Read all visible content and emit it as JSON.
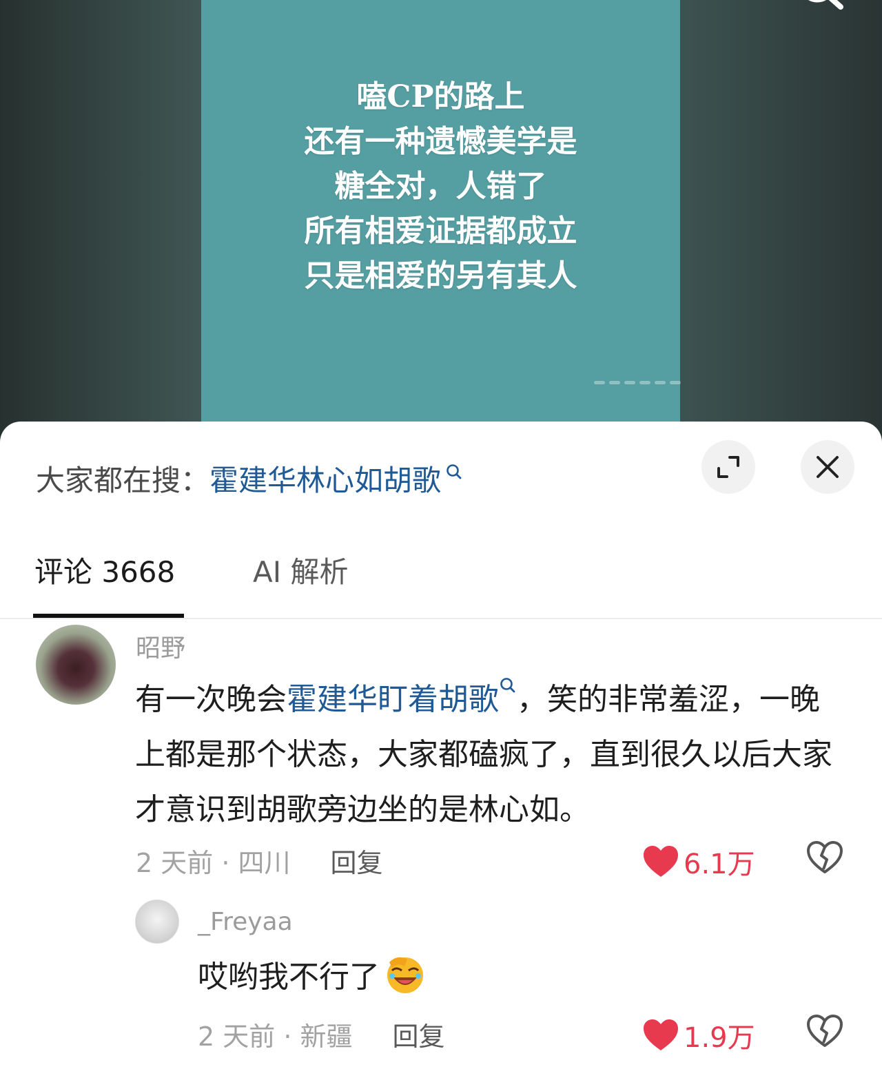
{
  "video": {
    "lines": [
      "嗑CP的路上",
      "还有一种遗憾美学是",
      "糖全对，人错了",
      "所有相爱证据都成立",
      "只是相爱的另有其人"
    ]
  },
  "hot_search": {
    "prefix": "大家都在搜：",
    "term": "霍建华林心如胡歌"
  },
  "tabs": [
    {
      "label": "评论 3668",
      "active": true
    },
    {
      "label": "AI 解析",
      "active": false
    }
  ],
  "comments": [
    {
      "username": "昭野",
      "text_before": "有一次晚会",
      "highlight": "霍建华盯着胡歌",
      "text_after": "，笑的非常羞涩，一晚上都是那个状态，大家都磕疯了，直到很久以后大家才意识到胡歌旁边坐的是林心如。",
      "meta": "2 天前 · 四川",
      "reply_label": "回复",
      "likes": "6.1万"
    },
    {
      "username": "_Freyaa",
      "text": "哎哟我不行了",
      "meta": "2 天前 · 新疆",
      "reply_label": "回复",
      "likes": "1.9万"
    }
  ],
  "colors": {
    "accent_blue": "#1f5a96",
    "like_red": "#e83a4f",
    "card_teal": "#559ea2"
  },
  "icons": [
    "search-icon",
    "expand-icon",
    "close-icon",
    "heart-icon",
    "broken-heart-icon",
    "laughing-emoji-icon"
  ]
}
